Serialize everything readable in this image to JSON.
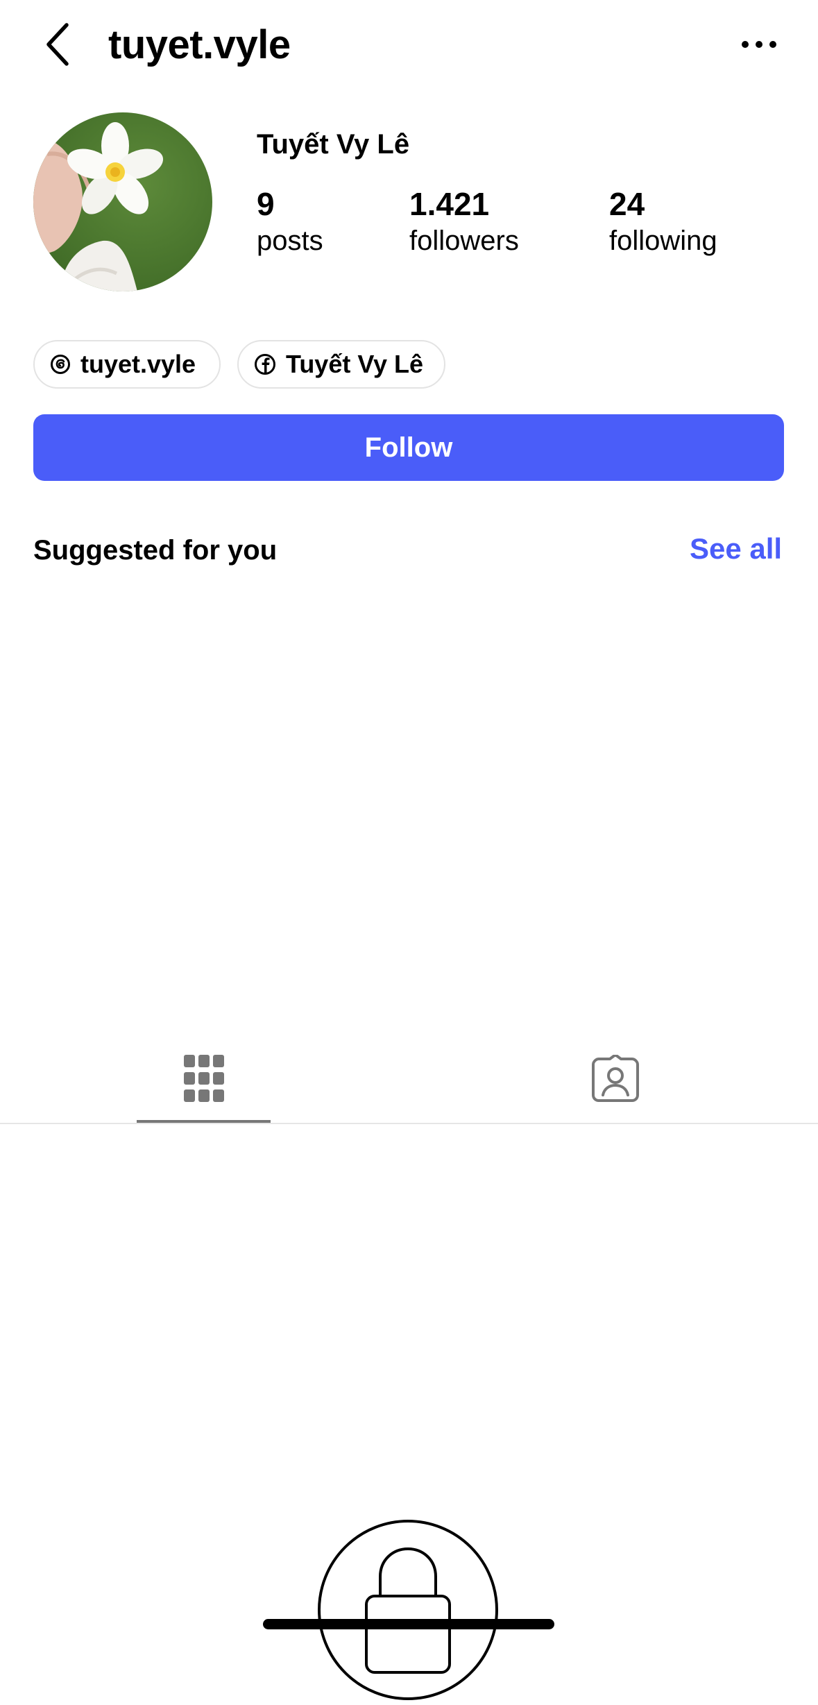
{
  "header": {
    "username": "tuyet.vyle",
    "back_icon": "chevron-left-icon",
    "more_icon": "more-horizontal-icon"
  },
  "profile": {
    "full_name": "Tuyết Vy Lê",
    "avatar_icon": "profile-photo-flower",
    "stats": {
      "posts": {
        "value": "9",
        "label": "posts"
      },
      "followers": {
        "value": "1.421",
        "label": "followers"
      },
      "following": {
        "value": "24",
        "label": "following"
      }
    }
  },
  "links": [
    {
      "icon": "threads-icon",
      "label": "tuyet.vyle"
    },
    {
      "icon": "facebook-icon",
      "label": "Tuyết Vy Lê"
    }
  ],
  "actions": {
    "follow_label": "Follow"
  },
  "suggested": {
    "title": "Suggested for you",
    "see_all_label": "See all"
  },
  "tabs": [
    {
      "icon": "grid-icon",
      "active": true
    },
    {
      "icon": "tagged-icon",
      "active": false
    }
  ],
  "private": {
    "icon": "lock-icon"
  },
  "colors": {
    "accent": "#4a5df9",
    "text": "#000000",
    "muted": "#777777",
    "chip_border": "#e3e3e3",
    "divider": "#e6e6e6"
  }
}
